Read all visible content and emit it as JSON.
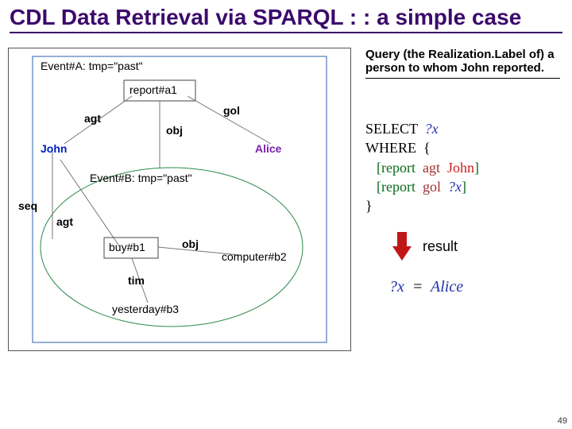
{
  "title": "CDL Data Retrieval via SPARQL : : a simple case",
  "query_description": "Query (the Realization.Label of) a person to whom John reported.",
  "diagram": {
    "eventA": "Event#A: tmp=\"past\"",
    "eventB": "Event#B: tmp=\"past\"",
    "report": "report#a1",
    "john": "John",
    "alice": "Alice",
    "buy": "buy#b1",
    "computer": "computer#b2",
    "yesterday": "yesterday#b3",
    "agt": "agt",
    "agt2": "agt",
    "obj": "obj",
    "obj2": "obj",
    "gol": "gol",
    "seq": "seq",
    "tim": "tim"
  },
  "sparql": {
    "select": "SELECT",
    "varx": "?x",
    "where": "WHERE",
    "lbrace": "{",
    "lbrack1": "[",
    "report1": "report",
    "agt": "agt",
    "john": "John",
    "rbrack1": "]",
    "lbrack2": "[",
    "report2": "report",
    "gol": "gol",
    "varx2": "?x",
    "rbrack2": "]",
    "rbrace": "}"
  },
  "result_label": "result",
  "answer": {
    "varx": "?x",
    "eq": "=",
    "value": "Alice"
  },
  "page_number": "49"
}
